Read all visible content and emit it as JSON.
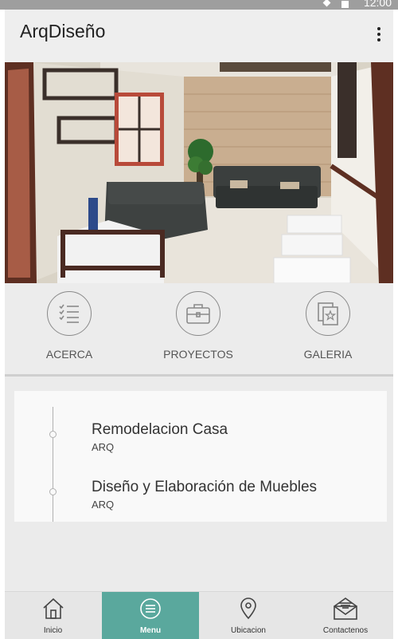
{
  "app": {
    "title": "ArqDiseño"
  },
  "status_bar": {
    "time": "12:00"
  },
  "hero": {
    "image": "office-reception-photo"
  },
  "quick_links": [
    {
      "label": "ACERCA",
      "icon": "checklist-icon"
    },
    {
      "label": "PROYECTOS",
      "icon": "briefcase-icon"
    },
    {
      "label": "GALERIA",
      "icon": "gallery-icon"
    }
  ],
  "projects": [
    {
      "title": "Remodelacion Casa",
      "subtitle": "ARQ"
    },
    {
      "title": "Diseño y Elaboración de Muebles",
      "subtitle": "ARQ"
    }
  ],
  "bottom_nav": [
    {
      "label": "Inicio",
      "icon": "home-icon",
      "active": false
    },
    {
      "label": "Menu",
      "icon": "menu-icon",
      "active": true
    },
    {
      "label": "Ubicacion",
      "icon": "location-pin-icon",
      "active": false
    },
    {
      "label": "Contactenos",
      "icon": "mail-icon",
      "active": false
    }
  ],
  "colors": {
    "accent": "#5aa89d",
    "status_bar": "#9e9e9e",
    "background": "#ebebeb"
  }
}
